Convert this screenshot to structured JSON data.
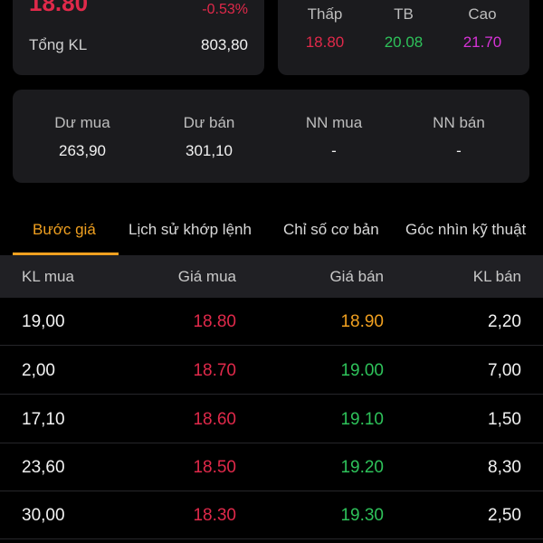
{
  "colors": {
    "red": "#e0294a",
    "green": "#2ec25a",
    "purple": "#d633d6",
    "yellow": "#f0a020",
    "white": "#f2f2f2"
  },
  "summary": {
    "price": "18.80",
    "change_pct": "-0.53%",
    "volume_label": "Tổng KL",
    "volume_value": "803,80"
  },
  "range": {
    "low_label": "Thấp",
    "low_value": "18.80",
    "avg_label": "TB",
    "avg_value": "20.08",
    "high_label": "Cao",
    "high_value": "21.70"
  },
  "orders": {
    "buy_rem_label": "Dư mua",
    "buy_rem_value": "263,90",
    "sell_rem_label": "Dư bán",
    "sell_rem_value": "301,10",
    "foreign_buy_label": "NN mua",
    "foreign_buy_value": "-",
    "foreign_sell_label": "NN bán",
    "foreign_sell_value": "-"
  },
  "tabs": [
    {
      "label": "Bước giá"
    },
    {
      "label": "Lịch sử khớp lệnh"
    },
    {
      "label": "Chỉ số cơ bản"
    },
    {
      "label": "Góc nhìn kỹ thuật"
    }
  ],
  "table": {
    "headers": [
      "KL mua",
      "Giá mua",
      "Giá bán",
      "KL bán"
    ],
    "rows": [
      {
        "buy_vol": "19,00",
        "buy_price": "18.80",
        "sell_price": "18.90",
        "sell_vol": "2,20",
        "buy_color": "red",
        "sell_color": "yellow"
      },
      {
        "buy_vol": "2,00",
        "buy_price": "18.70",
        "sell_price": "19.00",
        "sell_vol": "7,00",
        "buy_color": "red",
        "sell_color": "green"
      },
      {
        "buy_vol": "17,10",
        "buy_price": "18.60",
        "sell_price": "19.10",
        "sell_vol": "1,50",
        "buy_color": "red",
        "sell_color": "green"
      },
      {
        "buy_vol": "23,60",
        "buy_price": "18.50",
        "sell_price": "19.20",
        "sell_vol": "8,30",
        "buy_color": "red",
        "sell_color": "green"
      },
      {
        "buy_vol": "30,00",
        "buy_price": "18.30",
        "sell_price": "19.30",
        "sell_vol": "2,50",
        "buy_color": "red",
        "sell_color": "green"
      }
    ]
  }
}
